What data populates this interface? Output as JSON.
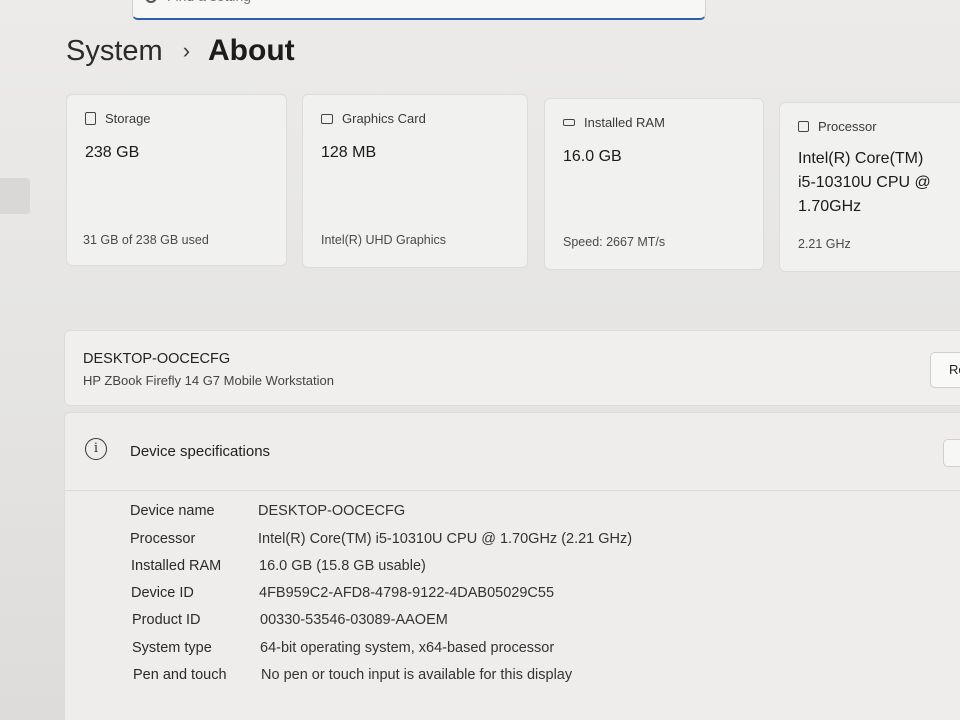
{
  "search": {
    "placeholder": "Find a setting"
  },
  "breadcrumb": {
    "parent": "System",
    "separator": "›",
    "current": "About"
  },
  "cards": [
    {
      "label": "Storage",
      "value": "238 GB",
      "sub": "31 GB of 238 GB used"
    },
    {
      "label": "Graphics Card",
      "value": "128 MB",
      "sub": "Intel(R) UHD Graphics"
    },
    {
      "label": "Installed RAM",
      "value": "16.0 GB",
      "sub": "Speed: 2667 MT/s"
    },
    {
      "label": "Processor",
      "value_lines": [
        "Intel(R) Core(TM)",
        "i5-10310U CPU @",
        "1.70GHz"
      ],
      "sub": "2.21 GHz"
    }
  ],
  "device": {
    "name": "DESKTOP-OOCECFG",
    "model": "HP ZBook Firefly 14 G7 Mobile Workstation",
    "rename_label": "Re"
  },
  "specs": {
    "title": "Device specifications",
    "rows": [
      {
        "label": "Device name",
        "value": "DESKTOP-OOCECFG"
      },
      {
        "label": "Processor",
        "value": "Intel(R) Core(TM) i5-10310U CPU @ 1.70GHz (2.21 GHz)"
      },
      {
        "label": "Installed RAM",
        "value": "16.0 GB (15.8 GB usable)"
      },
      {
        "label": "Device ID",
        "value": "4FB959C2-AFD8-4798-9122-4DAB05029C55"
      },
      {
        "label": "Product ID",
        "value": "00330-53546-03089-AAOEM"
      },
      {
        "label": "System type",
        "value": "64-bit operating system, x64-based processor"
      },
      {
        "label": "Pen and touch",
        "value": "No pen or touch input is available for this display"
      }
    ]
  },
  "colors": {
    "accent": "#2f5fa8",
    "card_bg": "#f1f1f0",
    "page_bg": "#e6e5e3"
  }
}
